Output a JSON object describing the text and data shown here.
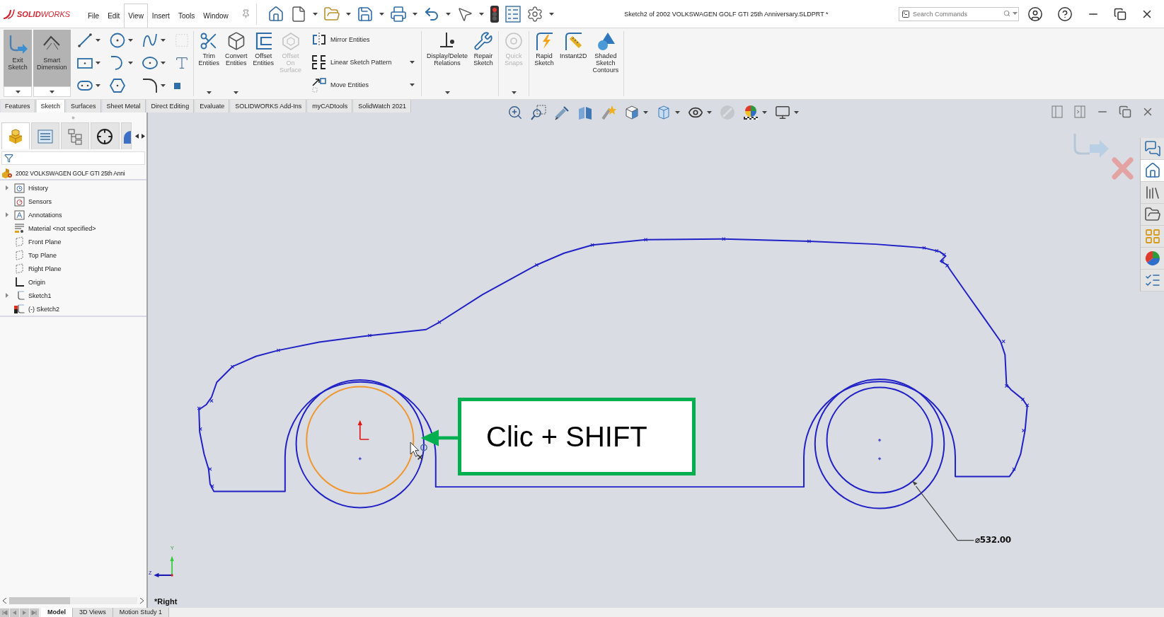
{
  "logo": {
    "text": "**SOLID**WORKS"
  },
  "menu": [
    {
      "label": "File",
      "selected": false
    },
    {
      "label": "Edit",
      "selected": false
    },
    {
      "label": "View",
      "selected": true
    },
    {
      "label": "Insert",
      "selected": false
    },
    {
      "label": "Tools",
      "selected": false
    },
    {
      "label": "Window",
      "selected": false
    }
  ],
  "window": {
    "title": "Sketch2 of 2002 VOLKSWAGEN GOLF GTI 25th Anniversary.SLDPRT *"
  },
  "search": {
    "placeholder": "Search Commands"
  },
  "ribbon": {
    "large_buttons": [
      {
        "kind": "exit-sketch",
        "label": "Exit Sketch",
        "active": true
      },
      {
        "kind": "smart-dimension",
        "label": "Smart Dimension",
        "active": true
      }
    ],
    "groups": [
      {
        "buttons": [
          {
            "kind": "trim",
            "label": "Trim Entities",
            "disabled": false,
            "dropdown": true
          },
          {
            "kind": "convert",
            "label": "Convert Entities",
            "disabled": false,
            "dropdown": true
          },
          {
            "kind": "offset",
            "label": "Offset Entities",
            "disabled": false,
            "dropdown": false
          },
          {
            "kind": "offset-surface",
            "label": "Offset On Surface",
            "disabled": true,
            "dropdown": false
          }
        ],
        "small_buttons": [
          {
            "kind": "mirror",
            "label": "Mirror Entities",
            "dropdown": false
          },
          {
            "kind": "linear-pattern",
            "label": "Linear Sketch Pattern",
            "dropdown": true
          },
          {
            "kind": "move",
            "label": "Move Entities",
            "dropdown": true
          }
        ]
      },
      {
        "buttons": [
          {
            "kind": "relations",
            "label": "Display/Delete Relations",
            "disabled": false,
            "dropdown": true
          },
          {
            "kind": "repair",
            "label": "Repair Sketch",
            "disabled": false,
            "dropdown": false
          }
        ]
      },
      {
        "buttons": [
          {
            "kind": "quick-snaps",
            "label": "Quick Snaps",
            "disabled": true,
            "dropdown": true
          }
        ]
      },
      {
        "buttons": [
          {
            "kind": "rapid-sketch",
            "label": "Rapid Sketch",
            "disabled": false,
            "dropdown": false
          },
          {
            "kind": "instant2d",
            "label": "Instant2D",
            "disabled": false,
            "dropdown": false
          },
          {
            "kind": "shaded-contours",
            "label": "Shaded Sketch Contours",
            "disabled": false,
            "dropdown": false
          }
        ]
      }
    ]
  },
  "tabs": [
    {
      "label": "Features",
      "selected": false
    },
    {
      "label": "Sketch",
      "selected": true
    },
    {
      "label": "Surfaces",
      "selected": false
    },
    {
      "label": "Sheet Metal",
      "selected": false
    },
    {
      "label": "Direct Editing",
      "selected": false
    },
    {
      "label": "Evaluate",
      "selected": false
    },
    {
      "label": "SOLIDWORKS Add-Ins",
      "selected": false
    },
    {
      "label": "myCADtools",
      "selected": false
    },
    {
      "label": "SolidWatch 2021",
      "selected": false
    }
  ],
  "feature_manager": {
    "panel_tabs": [
      {
        "kind": "features",
        "selected": true
      },
      {
        "kind": "properties",
        "selected": false
      },
      {
        "kind": "configurations",
        "selected": false
      },
      {
        "kind": "dimxpert",
        "selected": false
      },
      {
        "kind": "display",
        "selected": false
      }
    ],
    "root": "2002 VOLKSWAGEN GOLF GTI 25th Anni",
    "items": [
      {
        "kind": "history",
        "label": "History",
        "expandable": true,
        "editing": false
      },
      {
        "kind": "sensors",
        "label": "Sensors",
        "expandable": false,
        "editing": false
      },
      {
        "kind": "annotations",
        "label": "Annotations",
        "expandable": true,
        "editing": false
      },
      {
        "kind": "material",
        "label": "Material <not specified>",
        "expandable": false,
        "editing": false
      },
      {
        "kind": "plane",
        "label": "Front Plane",
        "expandable": false,
        "editing": false
      },
      {
        "kind": "plane",
        "label": "Top Plane",
        "expandable": false,
        "editing": false
      },
      {
        "kind": "plane",
        "label": "Right Plane",
        "expandable": false,
        "editing": false
      },
      {
        "kind": "origin",
        "label": "Origin",
        "expandable": false,
        "editing": false
      },
      {
        "kind": "sketch",
        "label": "Sketch1",
        "expandable": true,
        "editing": false
      },
      {
        "kind": "sketch",
        "label": "(-) Sketch2",
        "expandable": false,
        "editing": true
      }
    ]
  },
  "graphics": {
    "view_label": "*Right",
    "triad": {
      "y_label": "Y",
      "z_label": "Z"
    },
    "callout": {
      "text": "Clic + SHIFT"
    },
    "dimension": {
      "text": "⌀532.00"
    },
    "task_pane": [
      {
        "kind": "forum",
        "selected": false
      },
      {
        "kind": "home",
        "selected": true
      },
      {
        "kind": "library",
        "selected": false
      },
      {
        "kind": "explorer",
        "selected": false
      },
      {
        "kind": "palette",
        "selected": false
      },
      {
        "kind": "appearances",
        "selected": false
      },
      {
        "kind": "properties",
        "selected": false
      }
    ]
  },
  "bottom_tabs": [
    {
      "label": "Model",
      "selected": true
    },
    {
      "label": "3D Views",
      "selected": false
    },
    {
      "label": "Motion Study 1",
      "selected": false
    }
  ]
}
